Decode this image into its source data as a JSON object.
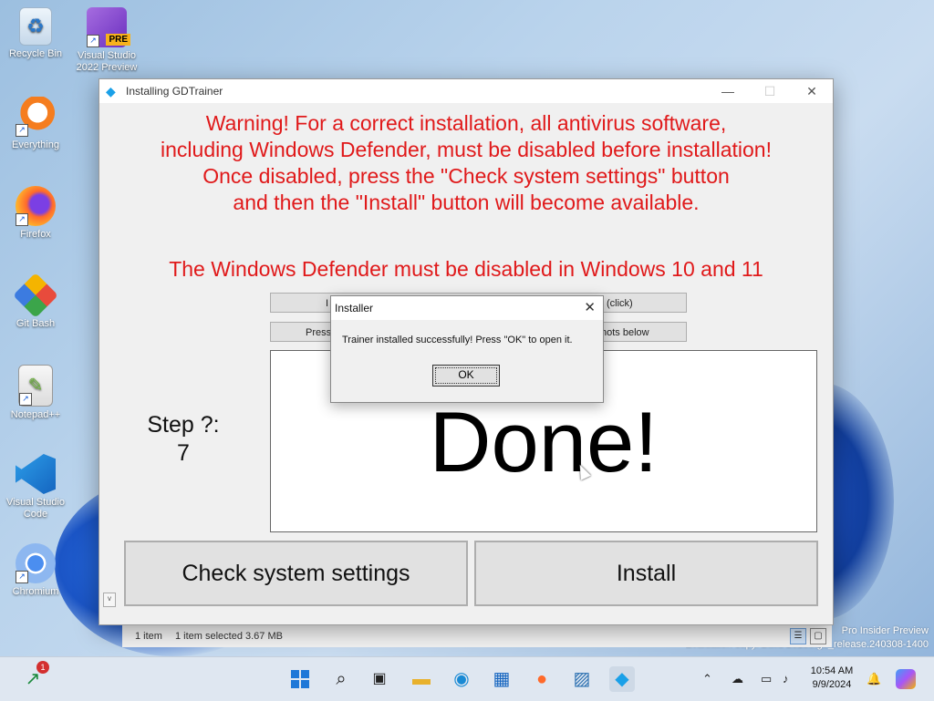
{
  "desktop": {
    "icons": [
      {
        "label": "Recycle Bin"
      },
      {
        "label": "Visual Studio 2022 Preview",
        "badge": "PRE"
      },
      {
        "label": "Everything"
      },
      {
        "label": "Firefox"
      },
      {
        "label": "Git Bash"
      },
      {
        "label": "Notepad++"
      },
      {
        "label": "Visual Studio Code"
      },
      {
        "label": "Chromium"
      }
    ],
    "watermark_line1": "Pro Insider Preview",
    "watermark_line2": "Evaluation copy. Build 26100.ge_release.240308-1400"
  },
  "window": {
    "title": "Installing GDTrainer",
    "minimize": "—",
    "maximize": "☐",
    "close": "✕",
    "warning_lines": [
      "Warning! For a correct installation, all antivirus software,",
      "including Windows Defender, must be disabled before installation!",
      "Once disabled, press the \"Check system settings\" button",
      "and then the \"Install\" button will become available."
    ],
    "defender_notice": "The Windows Defender must be disabled in Windows 10 and 11",
    "obscured_button_1_left": "I",
    "obscured_button_1_right": "(click)",
    "obscured_button_2_left": "Press",
    "obscured_button_2_right": "hots below",
    "done_text": "Done!",
    "step_label": "Step ?:",
    "step_value": "7",
    "check_button": "Check system settings",
    "install_button": "Install",
    "scroll_tiny": "v"
  },
  "statusbar": {
    "items": "1 item",
    "selected": "1 item selected  3.67 MB"
  },
  "dialog": {
    "title": "Installer",
    "close": "✕",
    "message": "Trainer installed successfully! Press \"OK\" to open it.",
    "ok": "OK"
  },
  "taskbar": {
    "time": "10:54 AM",
    "date": "9/9/2024",
    "notification_badge": "1"
  },
  "colors": {
    "warning_red": "#e0191a",
    "accent_blue": "#1a5fd6"
  }
}
